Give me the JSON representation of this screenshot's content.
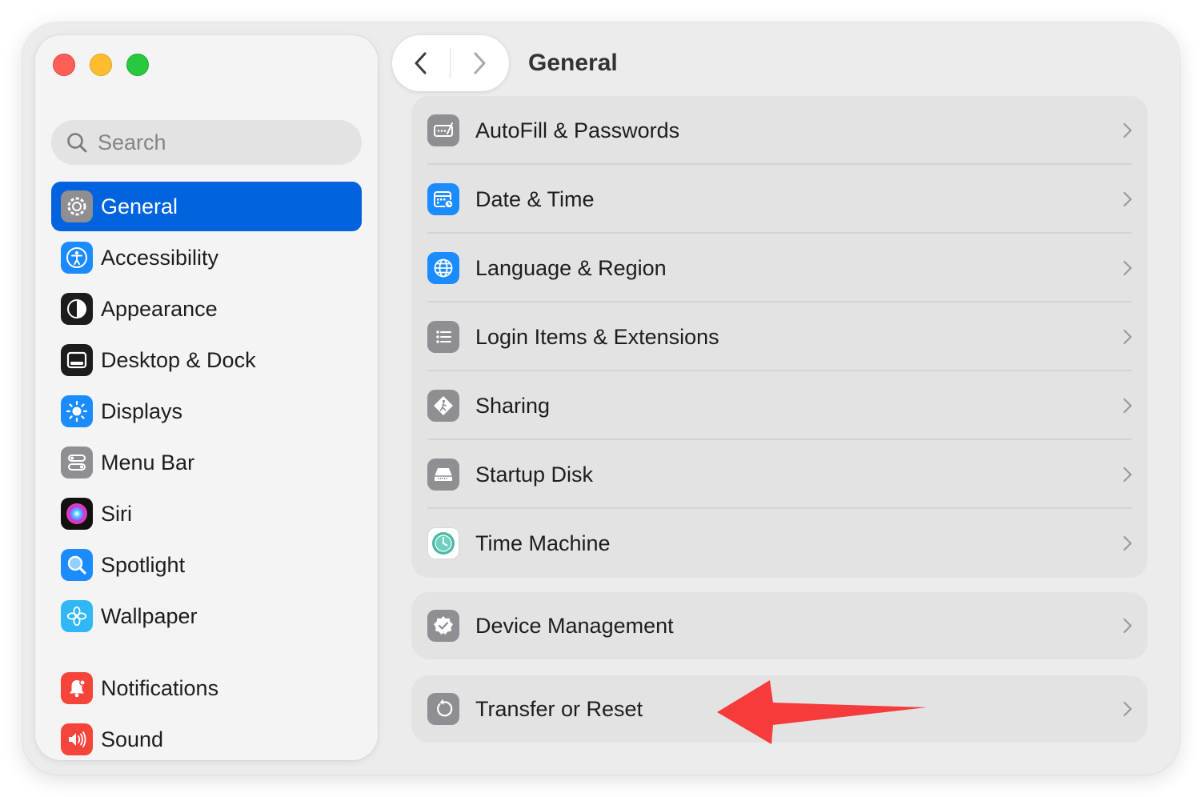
{
  "window": {
    "title": "General"
  },
  "search": {
    "placeholder": "Search"
  },
  "sidebar": {
    "items": [
      {
        "label": "General",
        "icon": "gear-icon",
        "color": "#8e8e93",
        "active": true
      },
      {
        "label": "Accessibility",
        "icon": "accessibility-icon",
        "color": "#1a8cff"
      },
      {
        "label": "Appearance",
        "icon": "appearance-icon",
        "color": "#1c1c1e"
      },
      {
        "label": "Desktop & Dock",
        "icon": "dock-icon",
        "color": "#1c1c1e"
      },
      {
        "label": "Displays",
        "icon": "brightness-icon",
        "color": "#1a8cff"
      },
      {
        "label": "Menu Bar",
        "icon": "menubar-icon",
        "color": "#8e8e93"
      },
      {
        "label": "Siri",
        "icon": "siri-icon",
        "color": "#5b3bd8"
      },
      {
        "label": "Spotlight",
        "icon": "magnifier-icon",
        "color": "#1a8cff"
      },
      {
        "label": "Wallpaper",
        "icon": "flower-icon",
        "color": "#2fb8f5"
      },
      {
        "label": "Notifications",
        "icon": "bell-icon",
        "color": "#f5453a"
      },
      {
        "label": "Sound",
        "icon": "speaker-icon",
        "color": "#f5453a"
      }
    ]
  },
  "main": {
    "groups": [
      {
        "rows": [
          {
            "label": "AutoFill & Passwords",
            "icon": "key-form-icon",
            "color": "#8e8e93"
          },
          {
            "label": "Date & Time",
            "icon": "calendar-clock-icon",
            "color": "#1a8cff"
          },
          {
            "label": "Language & Region",
            "icon": "globe-icon",
            "color": "#1a8cff"
          },
          {
            "label": "Login Items & Extensions",
            "icon": "list-icon",
            "color": "#8e8e93"
          },
          {
            "label": "Sharing",
            "icon": "sharing-icon",
            "color": "#8e8e93"
          },
          {
            "label": "Startup Disk",
            "icon": "disk-icon",
            "color": "#8e8e93"
          },
          {
            "label": "Time Machine",
            "icon": "time-machine-icon",
            "color": "#4cb8a6"
          }
        ]
      },
      {
        "rows": [
          {
            "label": "Device Management",
            "icon": "checkmark-badge-icon",
            "color": "#8e8e93"
          }
        ]
      },
      {
        "rows": [
          {
            "label": "Transfer or Reset",
            "icon": "reset-icon",
            "color": "#8e8e93"
          }
        ]
      }
    ]
  },
  "annotation": {
    "arrow_color": "#f53b3b",
    "points_to": "Transfer or Reset"
  }
}
